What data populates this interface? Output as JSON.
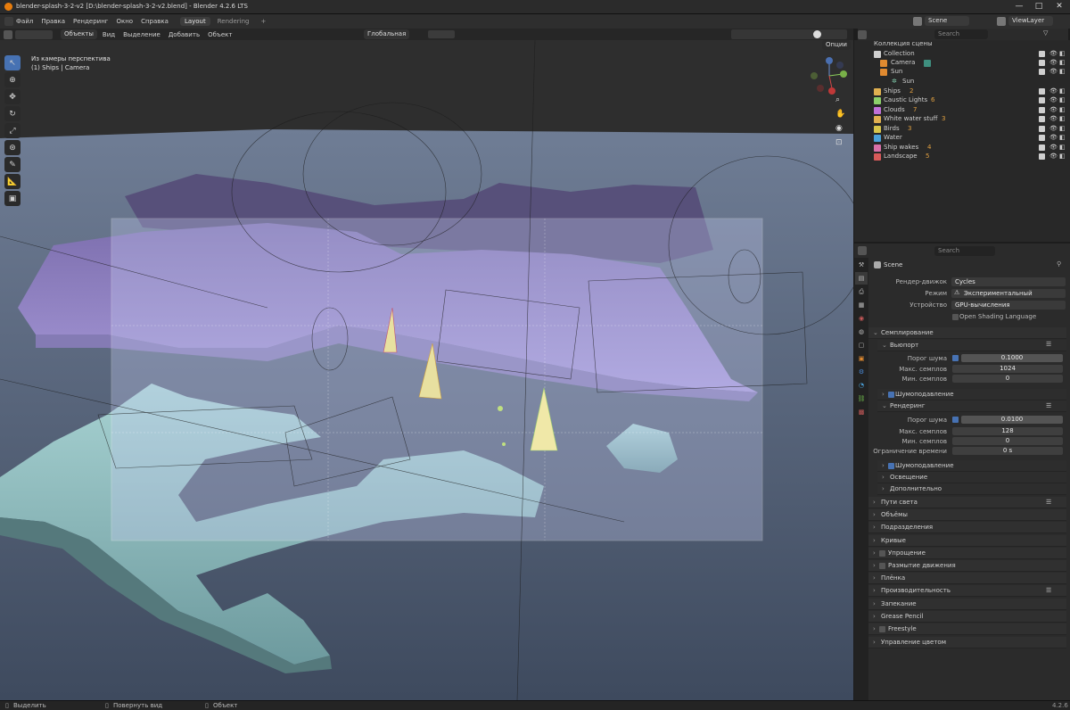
{
  "window": {
    "title": "blender-splash-3-2-v2 [D:\\blender-splash-3-2-v2.blend] - Blender 4.2.6 LTS",
    "minimize": "—",
    "maximize": "□",
    "close": "✕"
  },
  "menu": {
    "items": [
      "Файл",
      "Правка",
      "Рендеринг",
      "Окно",
      "Справка"
    ],
    "tabs": [
      "Layout",
      "Rendering"
    ],
    "add_tab": "+"
  },
  "workspace": {
    "scene_name": "Scene",
    "view_layer": "ViewLayer"
  },
  "viewport_header": {
    "mode": "Объекты",
    "menus": [
      "Вид",
      "Выделение",
      "Добавить",
      "Объект"
    ],
    "transform_orientation": "Глобальная",
    "options": "Опции"
  },
  "viewport": {
    "view_name": "Из камеры перспектива",
    "context": "(1) Ships | Camera"
  },
  "outliner": {
    "search_placeholder": "Search",
    "root": "Коллекция сцены",
    "rows": [
      {
        "label": "Collection",
        "color": "#cfcfcf"
      },
      {
        "label": "Camera",
        "color": "#cfcfcf"
      },
      {
        "label": "Sun",
        "color": "#cfcfcf"
      },
      {
        "label": "Sun",
        "color": "#7fc8a9"
      },
      {
        "label": "Ships",
        "color": "#e0b050"
      },
      {
        "label": "Caustic Lights",
        "color": "#8ccf6b"
      },
      {
        "label": "Clouds",
        "color": "#c070d8"
      },
      {
        "label": "White water stuff",
        "color": "#e0b050"
      },
      {
        "label": "Birds",
        "color": "#d8c54a"
      },
      {
        "label": "Water",
        "color": "#4aa0d8"
      },
      {
        "label": "Ship wakes",
        "color": "#d870a8"
      },
      {
        "label": "Landscape",
        "color": "#d85a5a"
      }
    ],
    "object_counts": {
      "ships": "2",
      "caustic": "6",
      "clouds": "7",
      "white_water": "3",
      "birds": "3",
      "ship_wakes": "4",
      "landscape": "5"
    }
  },
  "properties": {
    "search_placeholder": "Search",
    "context": "Scene",
    "render_engine_label": "Рендер-движок",
    "render_engine": "Cycles",
    "feature_set_label": "Режим",
    "feature_set": "Экспериментальный",
    "device_label": "Устройство",
    "device": "GPU-вычисления",
    "osl": "Open Shading Language",
    "sampling": "Семплирование",
    "viewport_section": "Вьюпорт",
    "noise_threshold_label": "Порог шума",
    "viewport_noise_threshold": "0.1000",
    "max_samples_label": "Макс. семплов",
    "viewport_max_samples": "1024",
    "min_samples_label": "Мин. семплов",
    "viewport_min_samples": "0",
    "denoise": "Шумоподавление",
    "render_section": "Рендеринг",
    "render_noise_threshold": "0.0100",
    "render_max_samples": "128",
    "render_min_samples": "0",
    "time_limit_label": "Ограничение времени",
    "render_time_limit": "0 s",
    "lights": "Освещение",
    "advanced": "Дополнительно",
    "panels": [
      "Пути света",
      "Объёмы",
      "Подразделения",
      "Кривые",
      "Упрощение",
      "Размытие движения",
      "Плёнка",
      "Производительность",
      "Запекание",
      "Grease Pencil",
      "Freestyle",
      "Управление цветом"
    ]
  },
  "statusbar": {
    "select": "Выделить",
    "rotate": "Повернуть вид",
    "object": "Объект",
    "version": "4.2.6"
  }
}
